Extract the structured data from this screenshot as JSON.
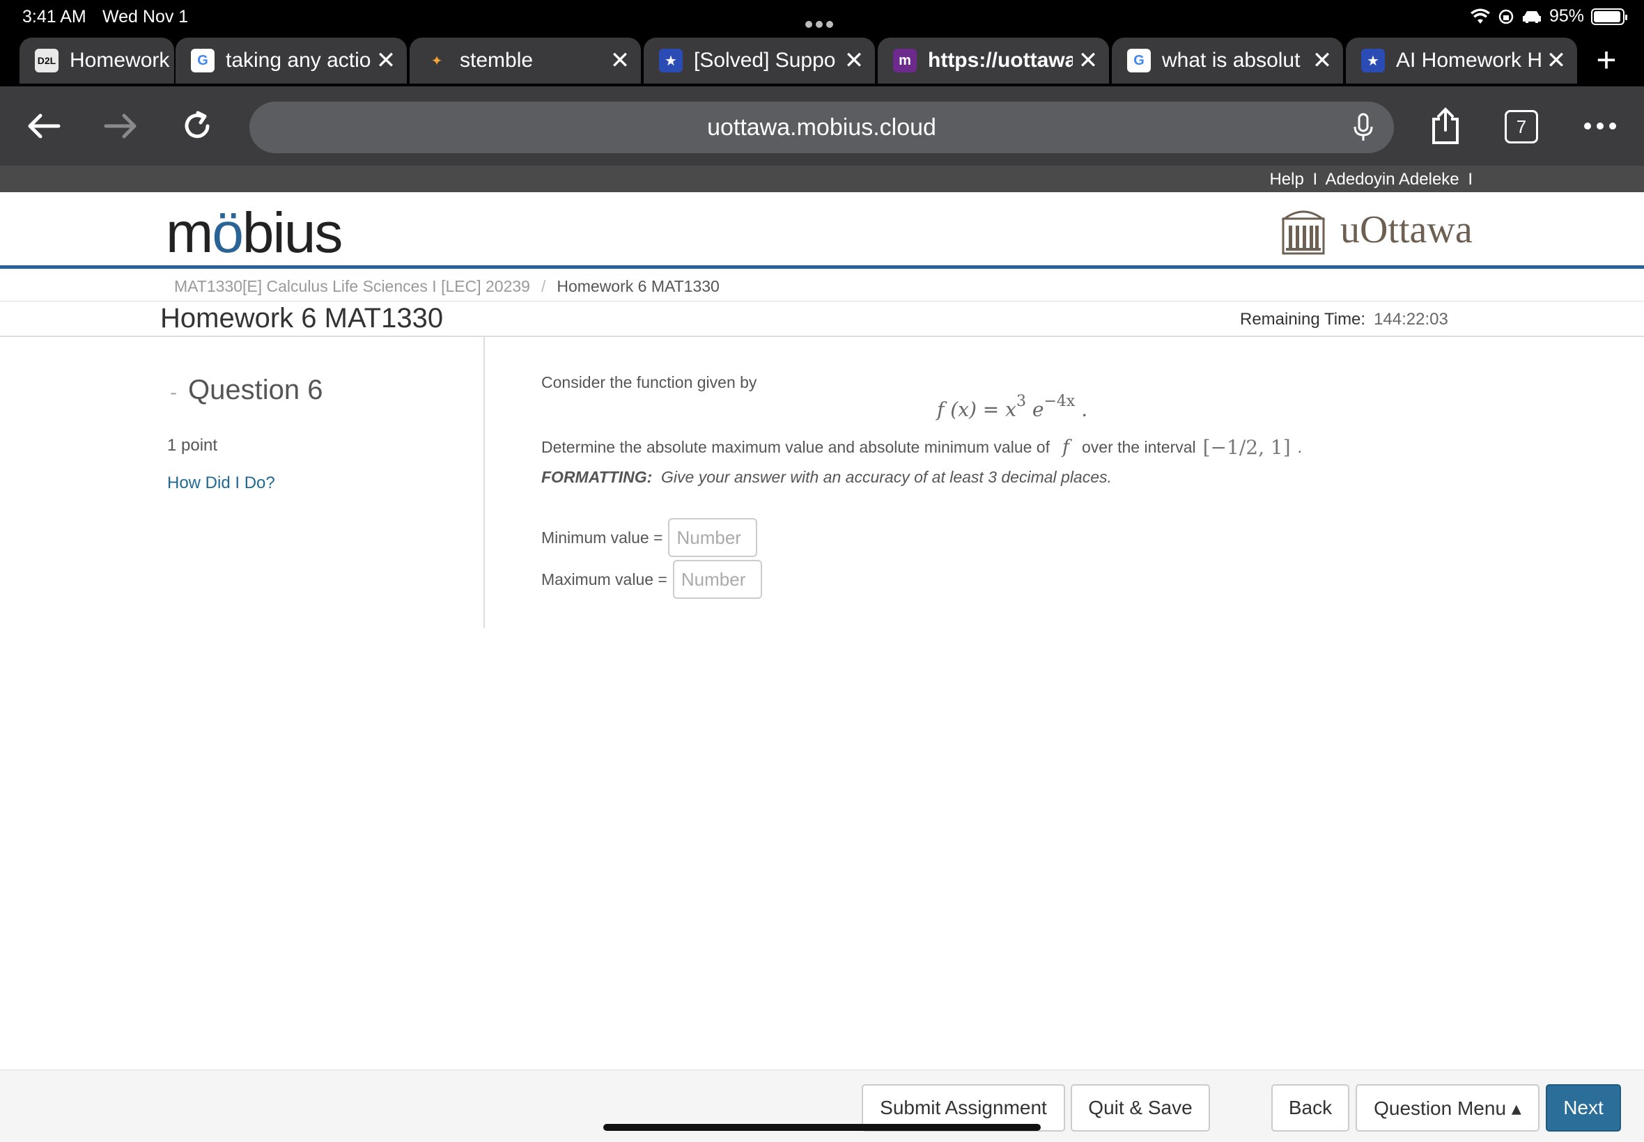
{
  "status": {
    "time": "3:41 AM",
    "date": "Wed Nov 1",
    "battery": "95%",
    "battery_level": 0.95
  },
  "tabs": [
    {
      "favicon": "D2L",
      "title": "Homework",
      "closable": false,
      "fav_color": "#111111",
      "fav_bg": "#e9e9e9"
    },
    {
      "favicon": "G",
      "title": "taking any actio",
      "closable": true,
      "fav_color": "#4285f4",
      "fav_bg": "#ffffff"
    },
    {
      "favicon": "✦",
      "title": "stemble",
      "closable": true,
      "fav_color": "#f4a43a",
      "fav_bg": "#3a3a3c"
    },
    {
      "favicon": "★",
      "title": "[Solved] Suppo",
      "closable": true,
      "fav_color": "#ffffff",
      "fav_bg": "#2a4cb4"
    },
    {
      "favicon": "m",
      "title": "https://uottawa",
      "closable": true,
      "fav_color": "#ffffff",
      "fav_bg": "#6b2a8c",
      "active": true
    },
    {
      "favicon": "G",
      "title": "what is absolut",
      "closable": true,
      "fav_color": "#4285f4",
      "fav_bg": "#ffffff"
    },
    {
      "favicon": "★",
      "title": "AI Homework H",
      "closable": true,
      "fav_color": "#ffffff",
      "fav_bg": "#2a4cb4"
    }
  ],
  "browser": {
    "url": "uottawa.mobius.cloud",
    "tab_count": "7"
  },
  "util": {
    "help": "Help",
    "sep": "I",
    "user": "Adedoyin Adeleke",
    "sep2": "I"
  },
  "header": {
    "logo": "möbius",
    "logo_pre": "m",
    "logo_o": "ö",
    "logo_post": "bius",
    "institution": "uOttawa"
  },
  "breadcrumb": {
    "course": "MAT1330[E] Calculus Life Sciences I [LEC] 20239",
    "slash": "/",
    "current": "Homework 6 MAT1330"
  },
  "page": {
    "title": "Homework 6 MAT1330",
    "remaining_label": "Remaining Time:",
    "remaining_value": "144:22:03"
  },
  "question": {
    "dash": "-",
    "heading": "Question 6",
    "points": "1 point",
    "help_link": "How Did I Do?",
    "intro": "Consider the function given by",
    "formula_lhs": "f (x) = x",
    "formula_exp1": "3",
    "formula_mid": " e",
    "formula_exp2": "−4x",
    "formula_end": " .",
    "line2_a": "Determine the absolute maximum value and absolute minimum value of",
    "line2_f": "f",
    "line2_b": "over the interval",
    "line2_interval": "[−1/2, 1]",
    "line2_end": ".",
    "formatting_label": "FORMATTING:",
    "formatting_text": "Give your answer with an accuracy of at least 3 decimal places.",
    "min_label": "Minimum value =",
    "max_label": "Maximum value =",
    "input_placeholder": "Number"
  },
  "footer": {
    "submit": "Submit Assignment",
    "quit": "Quit & Save",
    "back": "Back",
    "menu": "Question Menu ▴",
    "next": "Next"
  },
  "colors": {
    "accent": "#2a6496",
    "link": "#1f6a94",
    "next_button": "#2a6e99"
  }
}
